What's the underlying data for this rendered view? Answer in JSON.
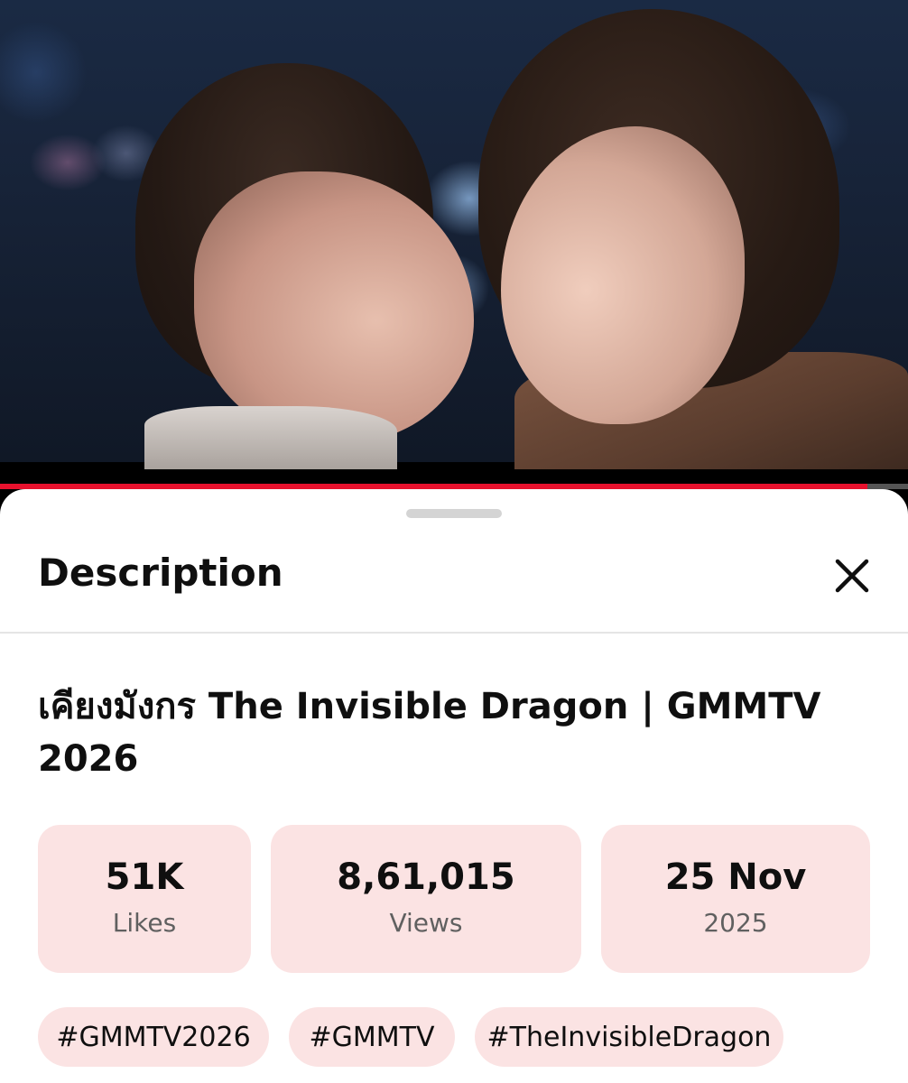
{
  "player": {
    "progress_percent": 95.5,
    "progress_color": "#e8112d"
  },
  "sheet": {
    "title": "Description",
    "close_icon": "close-icon"
  },
  "video": {
    "title": "เคียงมังกร The Invisible Dragon | GMMTV 2026"
  },
  "stats": [
    {
      "value": "51K",
      "label": "Likes"
    },
    {
      "value": "8,61,015",
      "label": "Views"
    },
    {
      "value": "25 Nov",
      "label": "2025"
    }
  ],
  "hashtags": [
    "#GMMTV2026",
    "#GMMTV",
    "#TheInvisibleDragon"
  ],
  "colors": {
    "chip_background": "#fbe3e3",
    "text_primary": "#0f0f0f",
    "text_secondary": "#606060"
  }
}
